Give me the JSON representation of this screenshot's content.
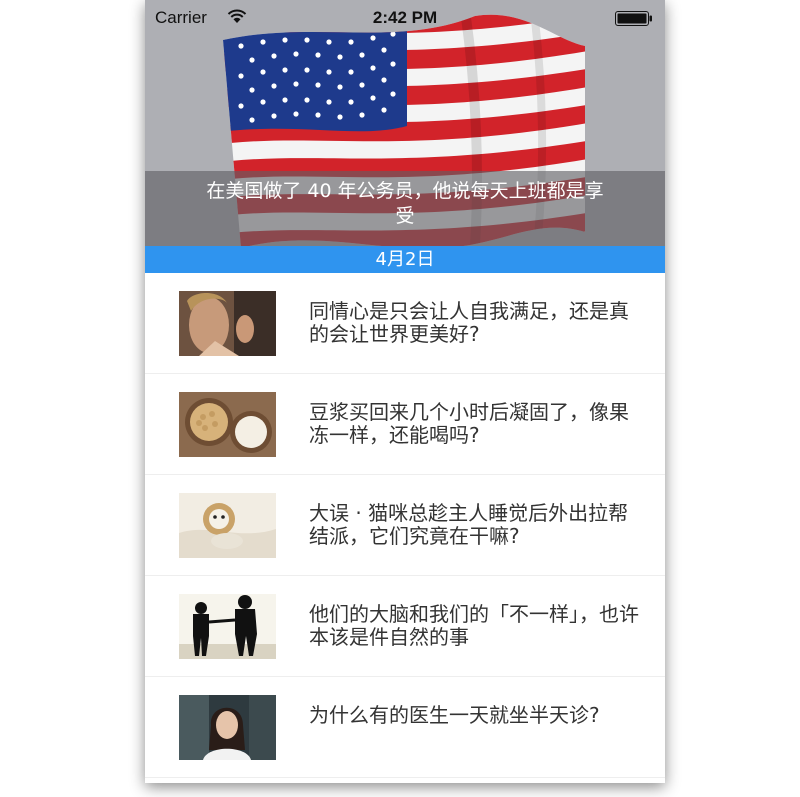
{
  "status_bar": {
    "carrier": "Carrier",
    "time": "2:42 PM"
  },
  "hero": {
    "caption": "在美国做了 40 年公务员，他说每天上班都是享受"
  },
  "date_header": "4月2日",
  "articles": [
    {
      "title": "同情心是只会让人自我满足，还是真的会让世界更美好?"
    },
    {
      "title": "豆浆买回来几个小时后凝固了，像果冻一样，还能喝吗?"
    },
    {
      "title": "大误 · 猫咪总趁主人睡觉后外出拉帮结派，它们究竟在干嘛?"
    },
    {
      "title": "他们的大脑和我们的「不一样」，也许本该是件自然的事"
    },
    {
      "title": "为什么有的医生一天就坐半天诊?"
    }
  ],
  "colors": {
    "date_bar": "#2f94ef",
    "caption_overlay": "#5f5f64"
  }
}
